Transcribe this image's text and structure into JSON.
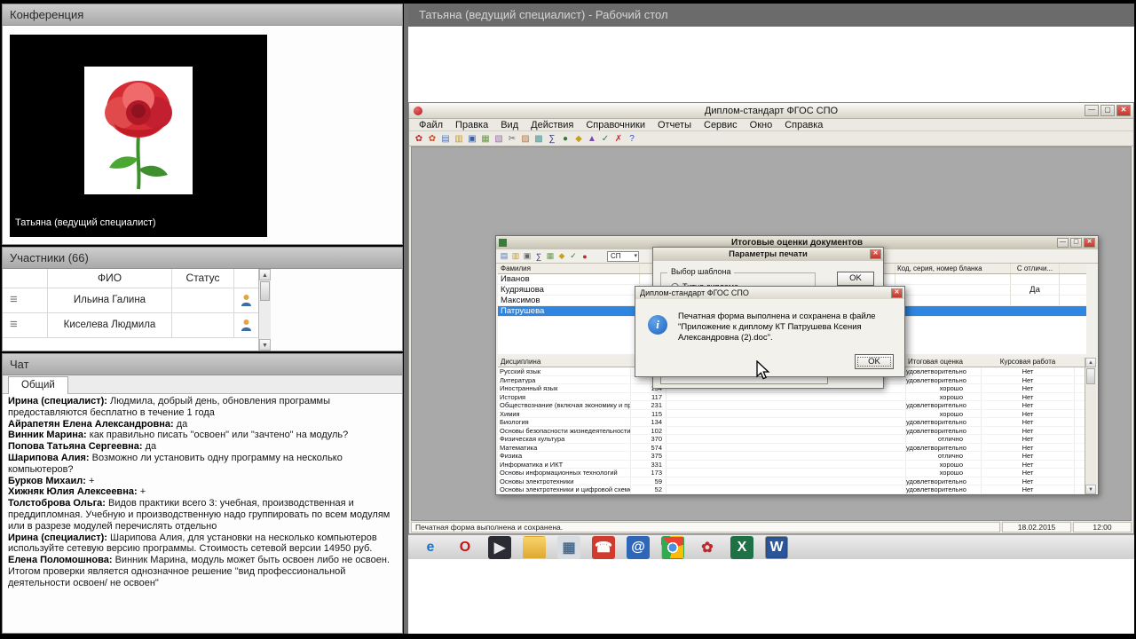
{
  "left": {
    "conference": {
      "title": "Конференция",
      "speaker": "Татьяна (ведущий специалист)"
    },
    "participants": {
      "title": "Участники (66)",
      "col_fio": "ФИО",
      "col_status": "Статус",
      "rows": [
        {
          "name": "Ильина Галина"
        },
        {
          "name": "Киселева Людмила"
        }
      ]
    },
    "chat": {
      "title": "Чат",
      "tab": "Общий",
      "messages": [
        {
          "author": "Ирина (специалист):",
          "text": "Людмила, добрый день, обновления программы предоставляются бесплатно в течение 1 года"
        },
        {
          "author": "Айрапетян Елена Александровна:",
          "text": "да"
        },
        {
          "author": "Винник Марина:",
          "text": "как правильно писать \"освоен\" или \"зачтено\" на модуль?"
        },
        {
          "author": "Попова Татьяна Сергеевна:",
          "text": "да"
        },
        {
          "author": "Шарипова Алия:",
          "text": "Возможно ли установить одну программу на несколько компьютеров?"
        },
        {
          "author": "Бурков Михаил:",
          "text": "+"
        },
        {
          "author": "Хижняк Юлия Алексеевна:",
          "text": "+"
        },
        {
          "author": "Толстоброва Ольга:",
          "text": "Видов практики всего 3: учебная, производственная и преддипломная. Учебную и производственную надо группировать по всем модулям или в разрезе модулей перечислять отдельно"
        },
        {
          "author": "Ирина (специалист):",
          "text": "Шарипова Алия, для установки на несколько компьютеров используйте сетевую версию программы. Стоимость сетевой версии 14950 руб."
        },
        {
          "author": "Елена Поломошнова:",
          "text": "Винник Марина, модуль может быть освоен либо не освоен. Итогом проверки является однозначное решение \"вид профессиональной деятельности освоен/ не освоен\""
        }
      ]
    }
  },
  "right": {
    "desktop_title": "Татьяна (ведущий специалист) - Рабочий стол",
    "app": {
      "title": "Диплом-стандарт ФГОС СПО",
      "menu": [
        "Файл",
        "Правка",
        "Вид",
        "Действия",
        "Справочники",
        "Отчеты",
        "Сервис",
        "Окно",
        "Справка"
      ],
      "toolbar_icons": [
        {
          "name": "app-rose-icon",
          "glyph": "✿",
          "color": "#c4252b"
        },
        {
          "name": "period-icon",
          "glyph": "✿",
          "color": "#d04a2a"
        },
        {
          "name": "new-icon",
          "glyph": "▤",
          "color": "#4a78c8"
        },
        {
          "name": "open-icon",
          "glyph": "▥",
          "color": "#c8972a"
        },
        {
          "name": "save-icon",
          "glyph": "▣",
          "color": "#3a5fa8"
        },
        {
          "name": "print-icon",
          "glyph": "▦",
          "color": "#6a9a4a"
        },
        {
          "name": "preview-icon",
          "glyph": "▧",
          "color": "#9a6ab0"
        },
        {
          "name": "cut-icon",
          "glyph": "✂",
          "color": "#666666"
        },
        {
          "name": "copy-icon",
          "glyph": "▨",
          "color": "#b07a4a"
        },
        {
          "name": "paste-icon",
          "glyph": "▩",
          "color": "#4a9a9a"
        },
        {
          "name": "sum-icon",
          "glyph": "∑",
          "color": "#32327a"
        },
        {
          "name": "refresh-icon",
          "glyph": "●",
          "color": "#2e7d32"
        },
        {
          "name": "reports-icon",
          "glyph": "◆",
          "color": "#c8a020"
        },
        {
          "name": "up-icon",
          "glyph": "▲",
          "color": "#7a4ab0"
        },
        {
          "name": "check-icon",
          "glyph": "✓",
          "color": "#2e7d32"
        },
        {
          "name": "delete-icon",
          "glyph": "✗",
          "color": "#c03030"
        },
        {
          "name": "help-icon",
          "glyph": "?",
          "color": "#2255cc"
        }
      ],
      "status": {
        "message": "Печатная форма выполнена и сохранена.",
        "date": "18.02.2015",
        "time": "12:00"
      }
    },
    "results_window": {
      "title": "Итоговые оценки документов",
      "toolbar_icons": [
        {
          "name": "grid-icon",
          "glyph": "▤",
          "color": "#4a78c8"
        },
        {
          "name": "open-icon",
          "glyph": "▥",
          "color": "#c8972a"
        },
        {
          "name": "print-icon",
          "glyph": "▣",
          "color": "#666666"
        },
        {
          "name": "sum-icon",
          "glyph": "∑",
          "color": "#32327a"
        },
        {
          "name": "table-icon",
          "glyph": "▦",
          "color": "#6a9a4a"
        },
        {
          "name": "filter-icon",
          "glyph": "◆",
          "color": "#c8a020"
        },
        {
          "name": "check-icon",
          "glyph": "✓",
          "color": "#2e7d32"
        },
        {
          "name": "close-doc-icon",
          "glyph": "●",
          "color": "#b03030"
        }
      ],
      "combo": "СП",
      "col_surname": "Фамилия",
      "col_code": "Код, серия, номер бланка",
      "col_honors": "С отличи...",
      "students": [
        {
          "surname": "Иванов",
          "honors": ""
        },
        {
          "surname": "Кудряшова",
          "honors": "Да"
        },
        {
          "surname": "Максимов",
          "honors": ""
        },
        {
          "surname": "Патрушева",
          "honors": "",
          "selected": true
        }
      ],
      "subjects_columns": {
        "discipline": "Дисциплина",
        "grade": "Итоговая оценка",
        "course": "Курсовая работа"
      },
      "subjects": [
        {
          "name": "Русский язык",
          "hours": "",
          "grade": "удовлетворительно",
          "course": "Нет"
        },
        {
          "name": "Литература",
          "hours": "",
          "grade": "удовлетворительно",
          "course": "Нет"
        },
        {
          "name": "Иностранный язык",
          "hours": "134",
          "grade": "хорошо",
          "course": "Нет"
        },
        {
          "name": "История",
          "hours": "117",
          "grade": "хорошо",
          "course": "Нет"
        },
        {
          "name": "Обществознание (включая экономику и право)",
          "hours": "231",
          "grade": "удовлетворительно",
          "course": "Нет"
        },
        {
          "name": "Химия",
          "hours": "115",
          "grade": "хорошо",
          "course": "Нет"
        },
        {
          "name": "Биология",
          "hours": "134",
          "grade": "удовлетворительно",
          "course": "Нет"
        },
        {
          "name": "Основы безопасности жизнедеятельности",
          "hours": "102",
          "grade": "удовлетворительно",
          "course": "Нет"
        },
        {
          "name": "Физическая культура",
          "hours": "370",
          "grade": "отлично",
          "course": "Нет"
        },
        {
          "name": "Математика",
          "hours": "574",
          "grade": "удовлетворительно",
          "course": "Нет"
        },
        {
          "name": "Физика",
          "hours": "375",
          "grade": "отлично",
          "course": "Нет"
        },
        {
          "name": "Информатика и ИКТ",
          "hours": "331",
          "grade": "хорошо",
          "course": "Нет"
        },
        {
          "name": "Основы информационных технологий",
          "hours": "173",
          "grade": "хорошо",
          "course": "Нет"
        },
        {
          "name": "Основы электротехники",
          "hours": "59",
          "grade": "удовлетворительно",
          "course": "Нет"
        },
        {
          "name": "Основы электротехники и цифровой схемотехники",
          "hours": "52",
          "grade": "удовлетворительно",
          "course": "Нет"
        }
      ]
    },
    "print_dialog": {
      "title": "Параметры печати",
      "group": "Выбор шаблона",
      "radio1": "Титул диплома",
      "ok": "OK"
    },
    "msgbox": {
      "title": "Диплом-стандарт ФГОС СПО",
      "text": "Печатная форма выполнена и сохранена в файле \"Приложение к диплому КТ Патрушева Ксения Александровна (2).doc\".",
      "ok": "OK"
    },
    "taskbar_icons": [
      {
        "name": "ie-icon",
        "glyph": "e",
        "color": "#1b75d0"
      },
      {
        "name": "opera-icon",
        "glyph": "O",
        "color": "#cc1016"
      },
      {
        "name": "media-player-icon",
        "glyph": "▶",
        "color": "#e8e8e8",
        "bg": "#2b2b33"
      },
      {
        "name": "folder-icon",
        "glyph": "",
        "color": "#9a7a20",
        "bg": "linear-gradient(#f7d36a,#e0a832)"
      },
      {
        "name": "system-app-icon",
        "glyph": "▦",
        "color": "#4a6a8a",
        "bg": "#d8dde2"
      },
      {
        "name": "phone-icon",
        "glyph": "☎",
        "color": "#ffffff",
        "bg": "#d23a2e"
      },
      {
        "name": "mail-icon",
        "glyph": "@",
        "color": "#ffffff",
        "bg": "#2e66b8"
      },
      {
        "name": "chrome-icon",
        "glyph": "",
        "color": "#ffffff",
        "bg": "radial-gradient(circle, #4a90e2 0 26%, #ffffff 26% 36%, rgba(0,0,0,0) 36%), conic-gradient(from -45deg, #ea4335 0 120deg, #fbbc05 0 240deg, #34a853 0 360deg)"
      },
      {
        "name": "rose-app-icon",
        "glyph": "✿",
        "color": "#c4252b"
      },
      {
        "name": "excel-icon",
        "glyph": "X",
        "color": "#ffffff",
        "bg": "#1e7145"
      },
      {
        "name": "word-icon",
        "glyph": "W",
        "color": "#ffffff",
        "bg": "#2b579a",
        "selected": true
      }
    ]
  }
}
